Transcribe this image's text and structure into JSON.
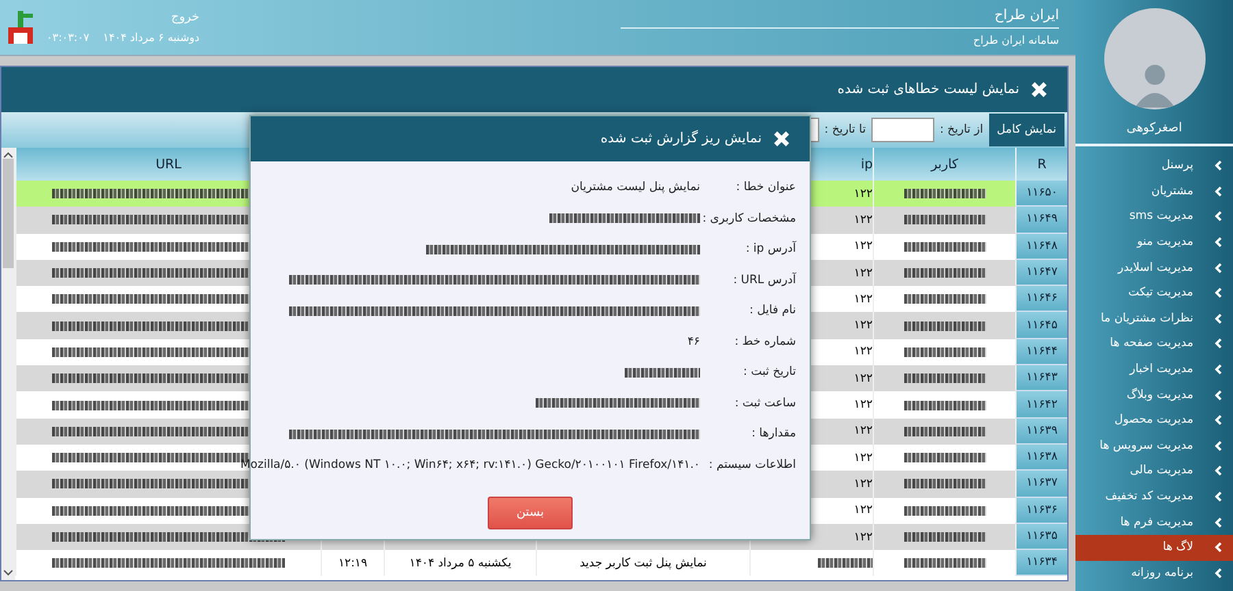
{
  "header": {
    "title": "ایران طراح",
    "subtitle": "سامانه ایران طراح",
    "logout": "خروج",
    "date": "دوشنبه ۶ مرداد ۱۴۰۴",
    "time": "۰۳:۰۳:۰۷"
  },
  "sidebar": {
    "user_name": "اصغرکوهی",
    "items": [
      {
        "label": "پرسنل",
        "selected": false
      },
      {
        "label": "مشتریان",
        "selected": false
      },
      {
        "label": "مدیریت sms",
        "selected": false
      },
      {
        "label": "مدیریت منو",
        "selected": false
      },
      {
        "label": "مدیریت اسلایدر",
        "selected": false
      },
      {
        "label": "مدیریت تیکت",
        "selected": false
      },
      {
        "label": "نظرات مشتریان ما",
        "selected": false
      },
      {
        "label": "مدیریت صفحه ها",
        "selected": false
      },
      {
        "label": "مدیریت اخبار",
        "selected": false
      },
      {
        "label": "مدیریت وبلاگ",
        "selected": false
      },
      {
        "label": "مدیریت محصول",
        "selected": false
      },
      {
        "label": "مدیریت سرویس ها",
        "selected": false
      },
      {
        "label": "مدیریت مالی",
        "selected": false
      },
      {
        "label": "مدیریت کد تخفیف",
        "selected": false
      },
      {
        "label": "مدیریت فرم ها",
        "selected": false
      },
      {
        "label": "لاگ ها",
        "selected": true
      },
      {
        "label": "برنامه روزانه",
        "selected": false
      }
    ]
  },
  "panel": {
    "title": "نمایش لیست خطاهای ثبت شده",
    "show_all_button": "نمایش کامل",
    "from_label": "از تاریخ :",
    "to_label": "تا تاریخ :"
  },
  "table": {
    "columns": [
      {
        "label": "R"
      },
      {
        "label": "کاربر"
      },
      {
        "label": "ip"
      },
      null,
      null,
      null,
      {
        "label": "URL"
      }
    ],
    "rows": [
      {
        "selected": true,
        "cells": [
          {
            "text": "۱۱۶۵۰"
          },
          {
            "redacted": true
          },
          {
            "text": "۱۲۲"
          },
          null,
          null,
          null,
          {
            "redacted": true
          }
        ]
      },
      {
        "selected": false,
        "cells": [
          {
            "text": "۱۱۶۴۹"
          },
          {
            "redacted": true
          },
          {
            "text": "۱۲۲"
          },
          null,
          null,
          null,
          {
            "redacted": true
          }
        ]
      },
      {
        "selected": false,
        "cells": [
          {
            "text": "۱۱۶۴۸"
          },
          {
            "redacted": true
          },
          {
            "text": "۱۲۲"
          },
          null,
          null,
          null,
          {
            "redacted": true
          }
        ]
      },
      {
        "selected": false,
        "cells": [
          {
            "text": "۱۱۶۴۷"
          },
          {
            "redacted": true
          },
          {
            "text": "۱۲۲"
          },
          null,
          null,
          null,
          {
            "redacted": true
          }
        ]
      },
      {
        "selected": false,
        "cells": [
          {
            "text": "۱۱۶۴۶"
          },
          {
            "redacted": true
          },
          {
            "text": "۱۲۲"
          },
          null,
          null,
          null,
          {
            "redacted": true
          }
        ]
      },
      {
        "selected": false,
        "cells": [
          {
            "text": "۱۱۶۴۵"
          },
          {
            "redacted": true
          },
          {
            "text": "۱۲۲"
          },
          null,
          null,
          null,
          {
            "redacted": true
          }
        ]
      },
      {
        "selected": false,
        "cells": [
          {
            "text": "۱۱۶۴۴"
          },
          {
            "redacted": true
          },
          {
            "text": "۱۲۲"
          },
          null,
          null,
          null,
          {
            "redacted": true
          }
        ]
      },
      {
        "selected": false,
        "cells": [
          {
            "text": "۱۱۶۴۳"
          },
          {
            "redacted": true
          },
          {
            "text": "۱۲۲"
          },
          null,
          null,
          null,
          {
            "redacted": true
          }
        ]
      },
      {
        "selected": false,
        "cells": [
          {
            "text": "۱۱۶۴۲"
          },
          {
            "redacted": true
          },
          {
            "text": "۱۲۲"
          },
          null,
          null,
          null,
          {
            "redacted": true
          }
        ]
      },
      {
        "selected": false,
        "cells": [
          {
            "text": "۱۱۶۳۹"
          },
          {
            "redacted": true
          },
          {
            "text": "۱۲۲"
          },
          null,
          null,
          null,
          {
            "redacted": true
          }
        ]
      },
      {
        "selected": false,
        "cells": [
          {
            "text": "۱۱۶۳۸"
          },
          {
            "redacted": true
          },
          {
            "text": "۱۲۲"
          },
          null,
          null,
          null,
          {
            "redacted": true
          }
        ]
      },
      {
        "selected": false,
        "cells": [
          {
            "text": "۱۱۶۳۷"
          },
          {
            "redacted": true
          },
          {
            "text": "۱۲۲"
          },
          null,
          null,
          null,
          {
            "redacted": true
          }
        ]
      },
      {
        "selected": false,
        "cells": [
          {
            "text": "۱۱۶۳۶"
          },
          {
            "redacted": true
          },
          {
            "text": "۱۲۲"
          },
          null,
          null,
          null,
          {
            "redacted": true
          }
        ]
      },
      {
        "selected": false,
        "cells": [
          {
            "text": "۱۱۶۳۵"
          },
          {
            "redacted": true
          },
          {
            "text": "۱۲۲"
          },
          null,
          null,
          null,
          {
            "redacted": true
          }
        ]
      },
      {
        "selected": false,
        "cells": [
          {
            "text": "۱۱۶۳۴"
          },
          {
            "redacted": true
          },
          {
            "redacted": true
          },
          {
            "text": "نمایش پنل ثبت کاربر جدید"
          },
          {
            "text": "یکشنبه ۵ مرداد ۱۴۰۴"
          },
          {
            "text": "۱۲:۱۹"
          },
          {
            "redacted": true
          }
        ]
      }
    ]
  },
  "modal": {
    "title": "نمایش ریز گزارش ثبت شده",
    "fields": [
      {
        "label": "عنوان خطا :",
        "value": "نمایش پنل لیست مشتریان",
        "redacted": false
      },
      {
        "label": "مشخصات کاربری :",
        "redacted": true
      },
      {
        "label": "آدرس ip :",
        "redacted": true
      },
      {
        "label": "آدرس URL :",
        "redacted": true
      },
      {
        "label": "نام فایل :",
        "redacted": true
      },
      {
        "label": "شماره خط :",
        "value": "۴۶",
        "redacted": false
      },
      {
        "label": "تاریخ ثبت :",
        "redacted": true
      },
      {
        "label": "ساعت ثبت :",
        "redacted": true
      },
      {
        "label": "مقدارها :",
        "redacted": true
      },
      {
        "label": "اطلاعات سیستم :",
        "value": "Mozilla/۵.۰ (Windows NT ۱۰.۰; Win۶۴; x۶۴; rv:۱۴۱.۰) Gecko/۲۰۱۰۰۱۰۱ Firefox/۱۴۱.۰",
        "redacted": false
      }
    ],
    "close_button": "بستن"
  }
}
